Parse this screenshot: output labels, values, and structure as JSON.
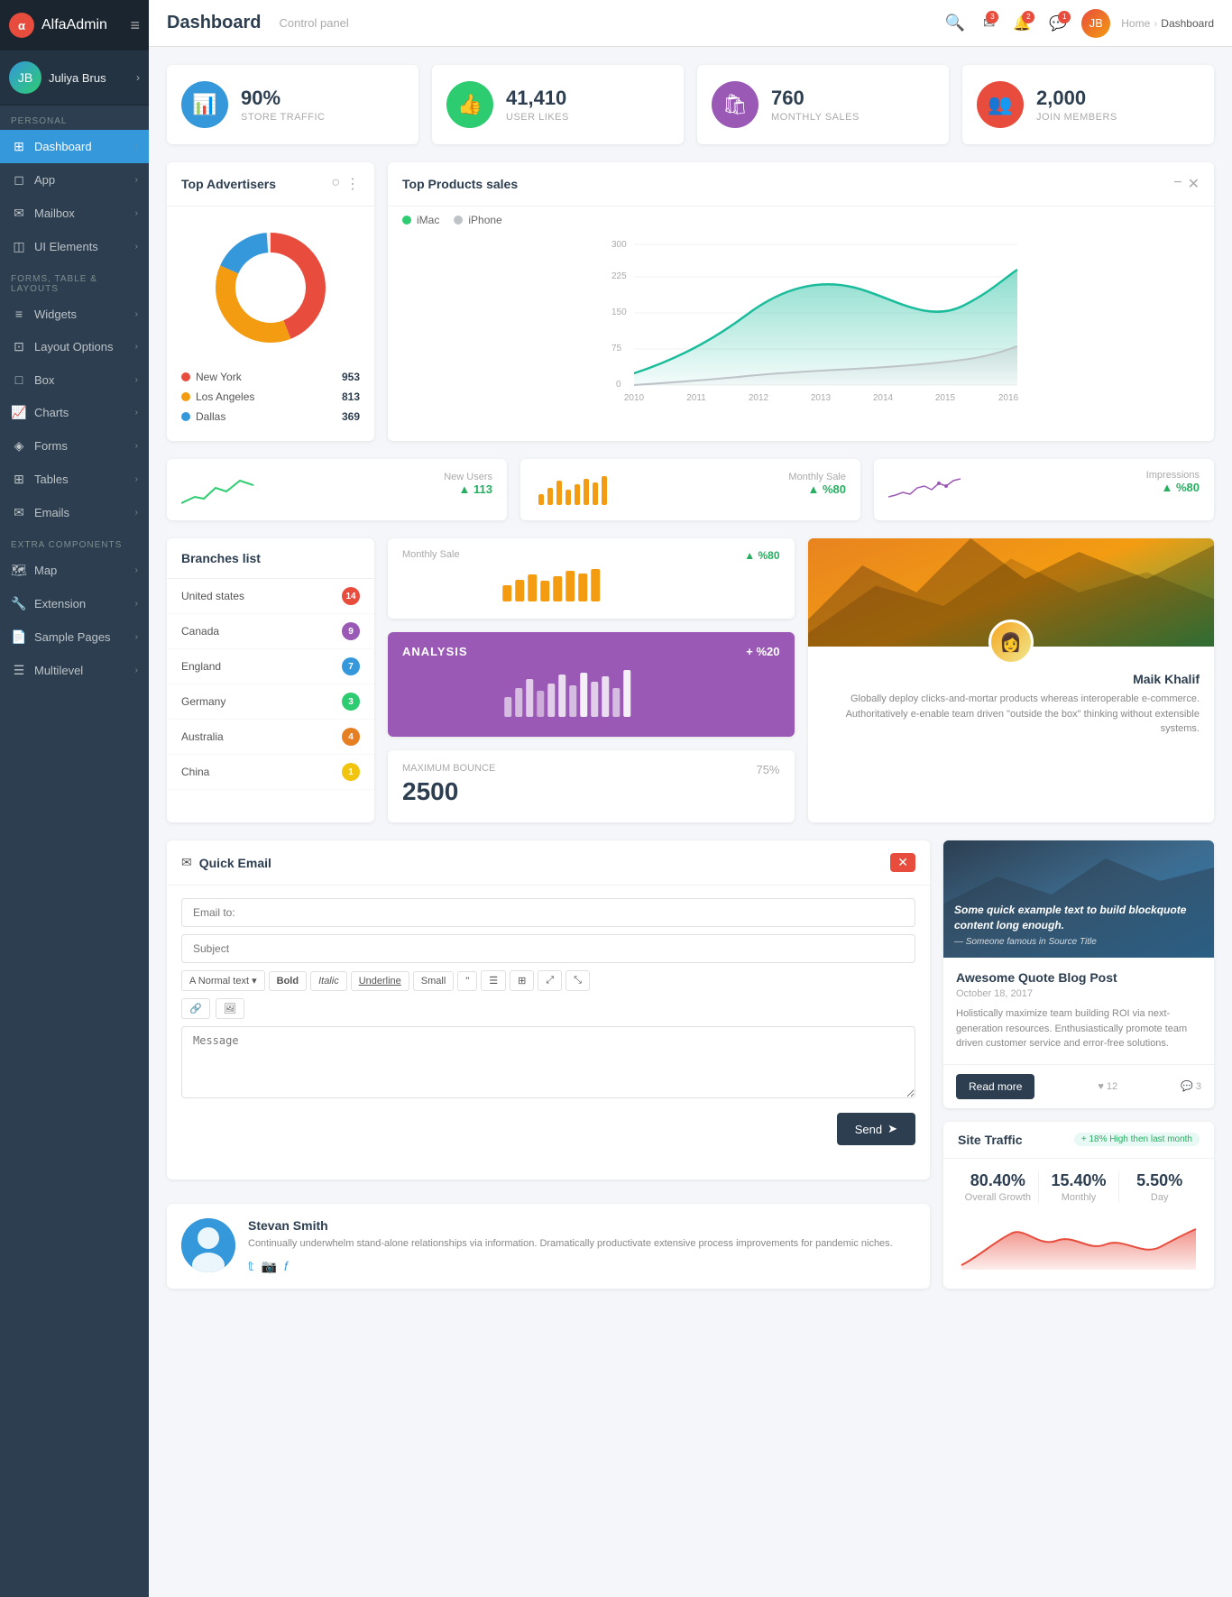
{
  "brand": {
    "logo": "α",
    "name_bold": "Alfa",
    "name_light": "Admin"
  },
  "user": {
    "name": "Juliya Brus",
    "avatar_text": "JB"
  },
  "topbar": {
    "title": "Dashboard",
    "subtitle": "Control panel",
    "breadcrumb_home": "Home",
    "breadcrumb_current": "Dashboard"
  },
  "stats": [
    {
      "icon": "📊",
      "icon_class": "blue",
      "value": "90%",
      "label": "STORE TRAFFIC"
    },
    {
      "icon": "👍",
      "icon_class": "green",
      "value": "41,410",
      "label": "USER LIKES"
    },
    {
      "icon": "🛍",
      "icon_class": "purple",
      "value": "760",
      "label": "MONTHLY SALES"
    },
    {
      "icon": "👥",
      "icon_class": "red",
      "value": "2,000",
      "label": "JOIN MEMBERS"
    }
  ],
  "sidebar": {
    "personal_label": "PERSONAL",
    "forms_label": "FORMS, TABLE & LAYOUTS",
    "extra_label": "EXTRA COMPONENTS",
    "items_personal": [
      {
        "icon": "⊞",
        "label": "Dashboard",
        "active": true
      },
      {
        "icon": "◻",
        "label": "App"
      },
      {
        "icon": "✉",
        "label": "Mailbox"
      },
      {
        "icon": "◫",
        "label": "UI Elements"
      }
    ],
    "items_forms": [
      {
        "icon": "≡",
        "label": "Widgets"
      },
      {
        "icon": "⊡",
        "label": "Layout Options"
      },
      {
        "icon": "□",
        "label": "Box"
      },
      {
        "icon": "📈",
        "label": "Charts"
      },
      {
        "icon": "◈",
        "label": "Forms"
      },
      {
        "icon": "⊞",
        "label": "Tables"
      },
      {
        "icon": "✉",
        "label": "Emails"
      }
    ],
    "items_extra": [
      {
        "icon": "🗺",
        "label": "Map"
      },
      {
        "icon": "🔧",
        "label": "Extension"
      },
      {
        "icon": "📄",
        "label": "Sample Pages"
      },
      {
        "icon": "☰",
        "label": "Multilevel"
      }
    ]
  },
  "top_advertisers": {
    "title": "Top Advertisers",
    "items": [
      {
        "label": "New York",
        "value": "953",
        "color": "#e74c3c"
      },
      {
        "label": "Los Angeles",
        "value": "813",
        "color": "#f39c12"
      },
      {
        "label": "Dallas",
        "value": "369",
        "color": "#3498db"
      }
    ]
  },
  "top_products": {
    "title": "Top Products sales",
    "legend": [
      {
        "label": "iMac",
        "color": "#2ecc71"
      },
      {
        "label": "iPhone",
        "color": "#bdc3c7"
      }
    ],
    "y_labels": [
      "300",
      "225",
      "150",
      "75",
      "0"
    ],
    "x_labels": [
      "2010",
      "2011",
      "2012",
      "2013",
      "2014",
      "2015",
      "2016"
    ]
  },
  "new_users": {
    "label": "New Users",
    "value": "113",
    "trend": "▲"
  },
  "monthly_sale": {
    "label": "Monthly Sale",
    "value": "%80",
    "trend": "▲"
  },
  "impressions": {
    "label": "Impressions",
    "value": "%80",
    "trend": "▲"
  },
  "branches": {
    "title": "Branches list",
    "items": [
      {
        "label": "United states",
        "value": "14",
        "color": "#e74c3c"
      },
      {
        "label": "Canada",
        "value": "9",
        "color": "#9b59b6"
      },
      {
        "label": "England",
        "value": "7",
        "color": "#3498db"
      },
      {
        "label": "Germany",
        "value": "3",
        "color": "#2ecc71"
      },
      {
        "label": "Australia",
        "value": "4",
        "color": "#e67e22"
      },
      {
        "label": "China",
        "value": "1",
        "color": "#f1c40f"
      }
    ]
  },
  "analysis": {
    "label": "ANALYSIS",
    "value": "+ %20"
  },
  "bounce": {
    "label": "MAXIMUM BOUNCE",
    "value": "2500",
    "pct": "75%"
  },
  "profile": {
    "name": "Maik Khalif",
    "desc": "Globally deploy clicks-and-mortar products whereas interoperable e-commerce. Authoritatively e-enable team driven \"outside the box\" thinking without extensible systems."
  },
  "quick_email": {
    "title": "Quick Email",
    "email_to_placeholder": "Email to:",
    "subject_placeholder": "Subject",
    "message_placeholder": "Message",
    "normal_text_label": "Normal text",
    "bold_label": "Bold",
    "italic_label": "Italic",
    "underline_label": "Underline",
    "small_label": "Small",
    "send_label": "Send"
  },
  "author": {
    "name": "Stevan Smith",
    "desc": "Continually underwhelm stand-alone relationships via information. Dramatically productivate extensive process improvements for pandemic niches.",
    "social": [
      "𝕥",
      "📸",
      "𝑓"
    ]
  },
  "blog": {
    "img_quote": "Some quick example text to build blockquote content long enough.",
    "img_author": "— Someone famous in Source Title",
    "title": "Awesome Quote Blog Post",
    "date": "October 18, 2017",
    "text": "Holistically maximize team building ROI via next-generation resources. Enthusiastically promote team driven customer service and error-free solutions.",
    "read_more": "Read more",
    "likes": "♥ 12",
    "comments": "💬 3"
  },
  "site_traffic": {
    "title": "Site Traffic",
    "badge": "+ 18% High then last month",
    "stats": [
      {
        "value": "80.40%",
        "label": "Overall Growth"
      },
      {
        "value": "15.40%",
        "label": "Monthly"
      },
      {
        "value": "5.50%",
        "label": "Day"
      }
    ]
  }
}
